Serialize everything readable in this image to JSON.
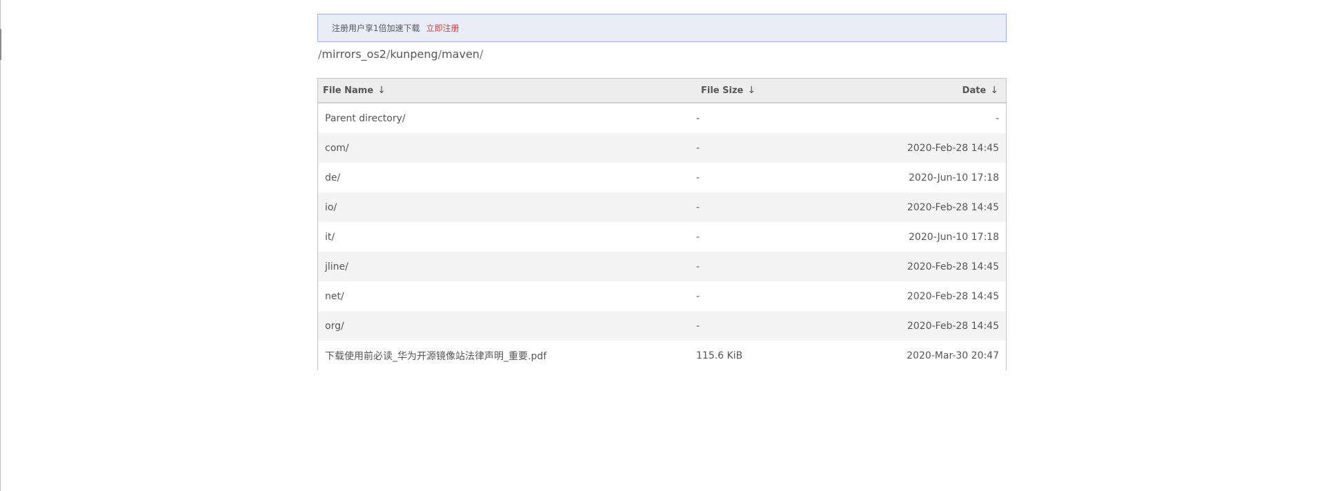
{
  "banner": {
    "promo_text": "注册用户享1倍加速下载",
    "register_link": "立即注册"
  },
  "breadcrumb": {
    "separator": "/",
    "items": [
      "mirrors_os2",
      "kunpeng",
      "maven"
    ]
  },
  "table": {
    "columns": {
      "name": "File Name",
      "size": "File Size",
      "date": "Date",
      "sort_arrow": "↓"
    },
    "rows": [
      {
        "name": "Parent directory/",
        "size": "-",
        "date": "-"
      },
      {
        "name": "com/",
        "size": "-",
        "date": "2020-Feb-28 14:45"
      },
      {
        "name": "de/",
        "size": "-",
        "date": "2020-Jun-10 17:18"
      },
      {
        "name": "io/",
        "size": "-",
        "date": "2020-Feb-28 14:45"
      },
      {
        "name": "it/",
        "size": "-",
        "date": "2020-Jun-10 17:18"
      },
      {
        "name": "jline/",
        "size": "-",
        "date": "2020-Feb-28 14:45"
      },
      {
        "name": "net/",
        "size": "-",
        "date": "2020-Feb-28 14:45"
      },
      {
        "name": "org/",
        "size": "-",
        "date": "2020-Feb-28 14:45"
      },
      {
        "name": "下载使用前必读_华为开源镜像站法律声明_重要.pdf",
        "size": "115.6 KiB",
        "date": "2020-Mar-30 20:47"
      }
    ]
  },
  "colors": {
    "banner_bg": "#e8edf8",
    "banner_border": "#9bb5ea",
    "register_link": "#e53935",
    "header_bg": "#ededed",
    "stripe_bg": "#f4f4f4"
  }
}
